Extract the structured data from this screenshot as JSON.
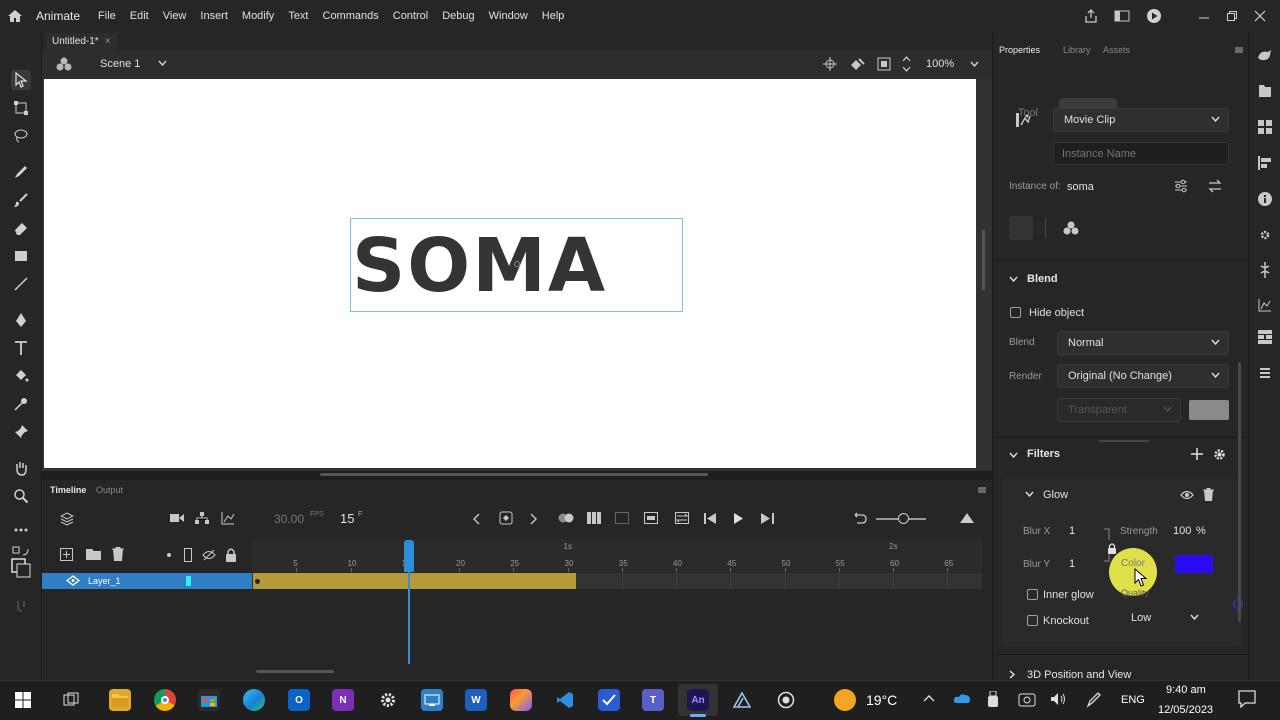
{
  "menubar": {
    "app_name": "Animate",
    "items": [
      "File",
      "Edit",
      "View",
      "Insert",
      "Modify",
      "Text",
      "Commands",
      "Control",
      "Debug",
      "Window",
      "Help"
    ]
  },
  "document": {
    "tab_title": "Untitled-1*",
    "scene": "Scene 1",
    "zoom": "100%",
    "stage_text": "SOMA"
  },
  "timeline": {
    "tabs": [
      "Timeline",
      "Output"
    ],
    "fps": "30.00",
    "fps_unit": "FPS",
    "frame": "15",
    "frame_unit": "F",
    "ruler_labels": [
      "5",
      "10",
      "15",
      "20",
      "25",
      "30",
      "35",
      "40",
      "45",
      "50",
      "55",
      "60",
      "65"
    ],
    "sec_labels": [
      "1s",
      "2s"
    ],
    "layer_name": "Layer_1"
  },
  "properties": {
    "tabs": [
      "Properties",
      "Library",
      "Assets"
    ],
    "segments": [
      "Tool",
      "Object",
      "Frame",
      "Doc"
    ],
    "symbol_type": "Movie Clip",
    "instance_placeholder": "Instance Name",
    "instance_of_label": "Instance of:",
    "instance_of_value": "soma",
    "blend_section": "Blend",
    "hide_object": "Hide object",
    "blend_label": "Blend",
    "blend_value": "Normal",
    "render_label": "Render",
    "render_value": "Original (No Change)",
    "transparent_value": "Transparent",
    "filters_section": "Filters",
    "glow_title": "Glow",
    "blur_x_label": "Blur X",
    "blur_x_value": "1",
    "blur_y_label": "Blur Y",
    "blur_y_value": "1",
    "strength_label": "Strength",
    "strength_value": "100",
    "strength_unit": "%",
    "color_label": "Color",
    "glow_color": "#2a0cf5",
    "inner_glow": "Inner glow",
    "knockout": "Knockout",
    "quality_label": "Quality",
    "quality_value": "Low",
    "section_3d": "3D Position and View"
  },
  "taskbar": {
    "weather": "19°C",
    "language": "ENG",
    "time": "9:40 am",
    "date": "12/05/2023",
    "an_label": "An",
    "n_label": "N",
    "o_label": "O",
    "w_label": "W"
  },
  "colors": {
    "accent": "#2e8fd8",
    "layer_span": "#b59a3a",
    "selection": "#7fc2e6"
  }
}
